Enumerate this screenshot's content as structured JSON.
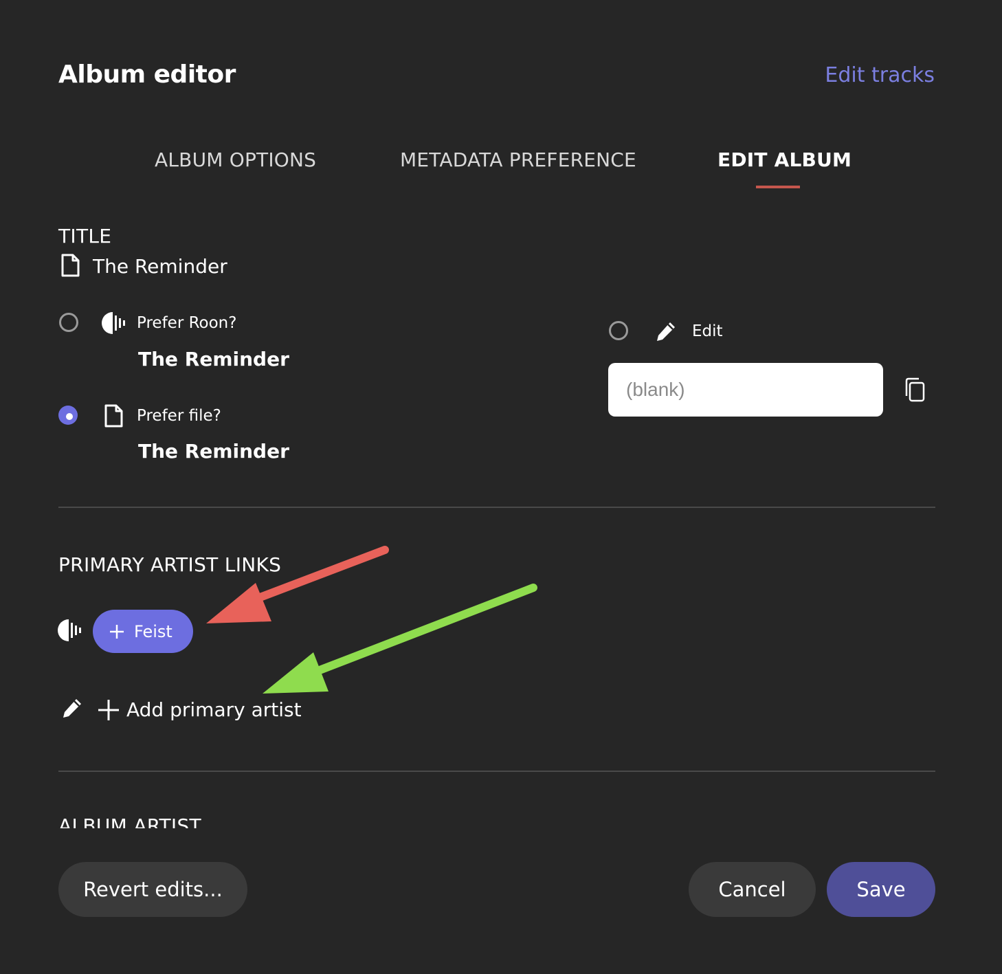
{
  "header": {
    "title": "Album editor",
    "edit_tracks_link": "Edit tracks"
  },
  "tabs": [
    {
      "label": "ALBUM OPTIONS",
      "active": false
    },
    {
      "label": "METADATA PREFERENCE",
      "active": false
    },
    {
      "label": "EDIT ALBUM",
      "active": true
    }
  ],
  "title_section": {
    "label": "TITLE",
    "current_value": "The Reminder",
    "current_icon": "file-icon",
    "options": [
      {
        "label": "Prefer Roon?",
        "value": "The Reminder",
        "icon": "roon-icon",
        "selected": false
      },
      {
        "label": "Prefer file?",
        "value": "The Reminder",
        "icon": "file-icon",
        "selected": true
      }
    ],
    "edit_option": {
      "label": "Edit",
      "icon": "pencil-icon",
      "selected": false,
      "input_value": "",
      "input_placeholder": "(blank)",
      "copy_icon": "copy-icon"
    }
  },
  "primary_artist_section": {
    "label": "PRIMARY ARTIST LINKS",
    "artists": [
      {
        "name": "Feist",
        "source_icon": "roon-icon"
      }
    ],
    "add_label": "Add primary artist"
  },
  "next_section_label": "ALBUM ARTIST",
  "annotations": {
    "red_arrow_color": "#e8625a",
    "green_arrow_color": "#8fdc4e"
  },
  "footer": {
    "revert_label": "Revert edits...",
    "cancel_label": "Cancel",
    "save_label": "Save"
  },
  "colors": {
    "background": "#262626",
    "accent": "#6d6ee0",
    "link": "#7b7fe0",
    "tab_underline": "#c5574d",
    "save_button": "#4f4f98"
  }
}
